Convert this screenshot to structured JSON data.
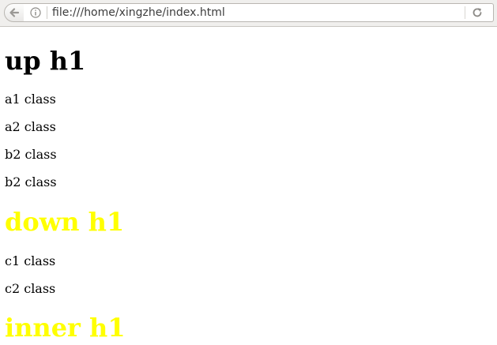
{
  "browser": {
    "url": "file:///home/xingzhe/index.html",
    "icons": {
      "back": "back-arrow-icon",
      "info": "info-icon",
      "reload": "reload-icon"
    }
  },
  "page": {
    "headings": [
      {
        "text": "up h1",
        "color": "#000000"
      },
      {
        "text": "down h1",
        "color": "#ffff00"
      },
      {
        "text": "inner h1",
        "color": "#ffff00"
      }
    ],
    "paragraphs": [
      "a1 class",
      "a2 class",
      "b2 class",
      "b2 class",
      "c1 class",
      "c2 class"
    ]
  }
}
